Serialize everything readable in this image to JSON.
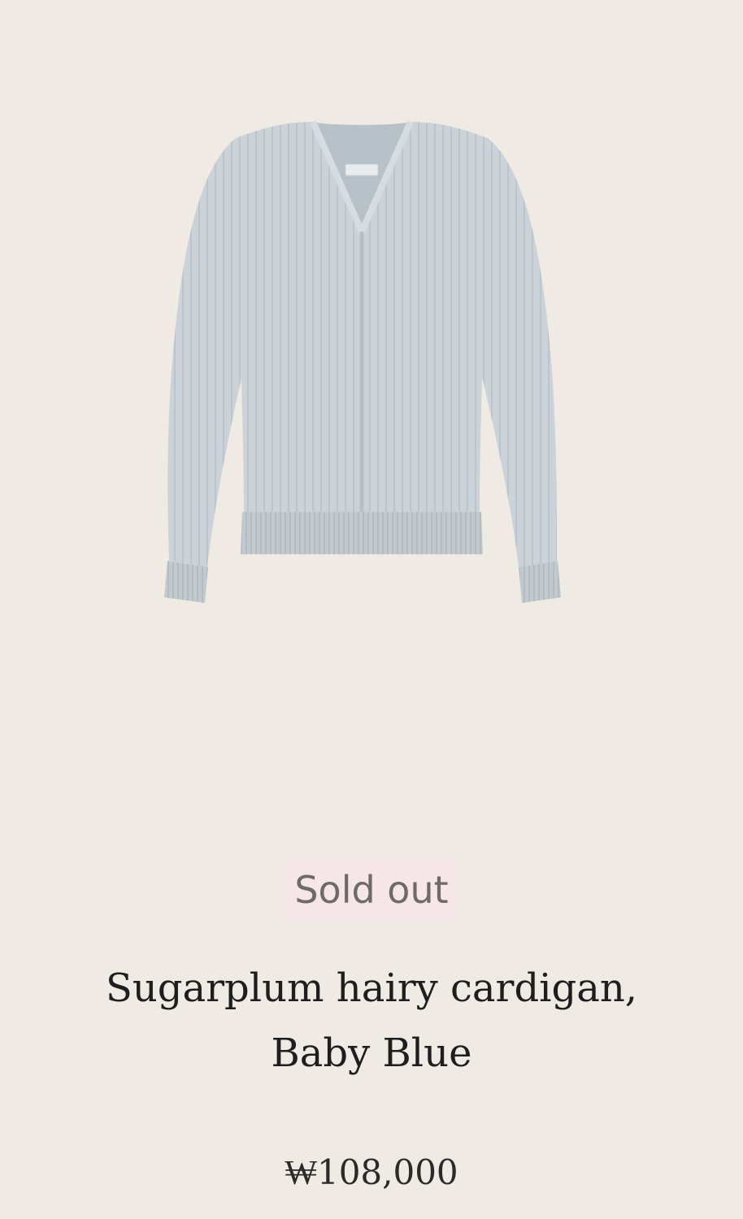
{
  "product": {
    "image_icon": "cardigan-image",
    "status_badge": "Sold out",
    "title_line1": "Sugarplum hairy cardigan,",
    "title_line2": "Baby Blue",
    "price": "₩108,000"
  },
  "colors": {
    "background": "#efebe4",
    "badge_background": "#f6e6ea",
    "garment": "#c9d1d6"
  }
}
